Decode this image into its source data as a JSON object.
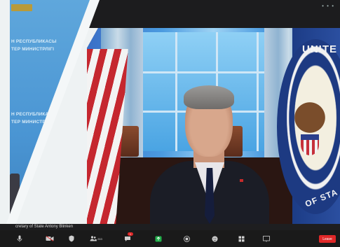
{
  "window": {
    "menu_dots": "• • •"
  },
  "left_tile": {
    "wall_text_1": "Н РЕСПУБЛИКАСЫ",
    "wall_text_2": "ТЕР МИНИСТРЛІГІ",
    "wall_text_3": "Н РЕСПУБЛИКАСЫ",
    "wall_text_4": "ТЕР МИНИСТРЛІГІ"
  },
  "main_tile": {
    "seal_top": "UNITE",
    "seal_bottom": "OF STA"
  },
  "caption": {
    "speaker_name": "cretary of State Antony Blinken"
  },
  "toolbar": {
    "items": [
      {
        "name": "mute",
        "icon": "microphone-icon",
        "label": ""
      },
      {
        "name": "video",
        "icon": "camera-icon",
        "label": ""
      },
      {
        "name": "security",
        "icon": "shield-icon",
        "label": ""
      },
      {
        "name": "participants",
        "icon": "people-icon",
        "label": "",
        "count": "263"
      },
      {
        "name": "chat",
        "icon": "chat-icon",
        "label": ""
      },
      {
        "name": "share",
        "icon": "share-screen-icon",
        "label": ""
      },
      {
        "name": "record",
        "icon": "record-icon",
        "label": ""
      },
      {
        "name": "reactions",
        "icon": "reactions-icon",
        "label": ""
      },
      {
        "name": "apps",
        "icon": "apps-icon",
        "label": ""
      },
      {
        "name": "whiteboard",
        "icon": "whiteboard-icon",
        "label": ""
      }
    ],
    "chat_badge": "1",
    "leave_label": "Leave"
  },
  "colors": {
    "toolbar_bg": "#1a1a1a",
    "leave": "#e02828",
    "share_green": "#22b04b"
  }
}
